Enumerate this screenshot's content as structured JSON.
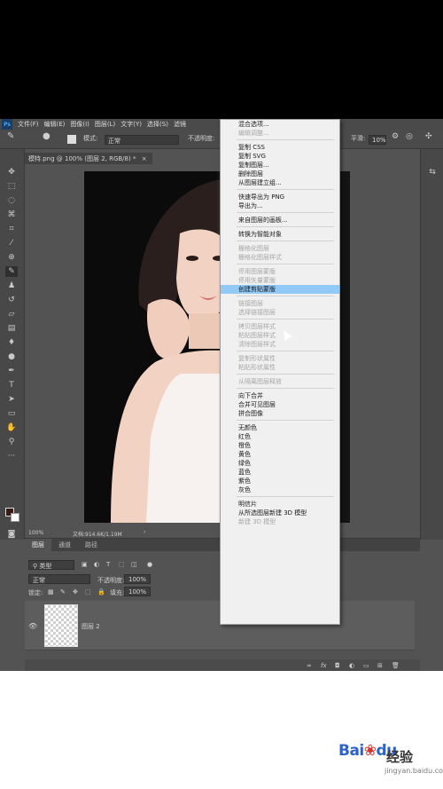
{
  "menubar": {
    "app_icon": "Ps",
    "items": [
      "文件(F)",
      "编辑(E)",
      "图像(I)",
      "图层(L)",
      "文字(Y)",
      "选择(S)",
      "滤镜"
    ]
  },
  "options": {
    "mode_label": "模式:",
    "mode_value": "正常",
    "opacity_label": "不透明度:",
    "smooth_label": "平滑:",
    "smooth_value": "10%"
  },
  "document": {
    "tab_title": "模特.png @ 100% (图层 2, RGB/8) *",
    "zoom": "100%",
    "doc_size": "文档:914.6K/1.19M"
  },
  "layers_panel": {
    "tabs": [
      "图层",
      "通道",
      "路径"
    ],
    "filter_kind": "类型",
    "blend_mode": "正常",
    "opacity_label": "不透明度:",
    "opacity_value": "100%",
    "lock_label": "锁定:",
    "fill_label": "填充:",
    "fill_value": "100%",
    "layer_name": "图层 2"
  },
  "context_menu": {
    "items": [
      {
        "label": "混合选项...",
        "disabled": false
      },
      {
        "label": "编辑调整...",
        "disabled": true
      },
      {
        "sep": true
      },
      {
        "label": "复制 CSS",
        "disabled": false
      },
      {
        "label": "复制 SVG",
        "disabled": false
      },
      {
        "label": "复制图层...",
        "disabled": false
      },
      {
        "label": "删除图层",
        "disabled": false
      },
      {
        "label": "从图层建立组...",
        "disabled": false
      },
      {
        "sep": true
      },
      {
        "label": "快速导出为 PNG",
        "disabled": false
      },
      {
        "label": "导出为...",
        "disabled": false
      },
      {
        "sep": true
      },
      {
        "label": "来自图层的画板...",
        "disabled": false
      },
      {
        "sep": true
      },
      {
        "label": "转换为智能对象",
        "disabled": false
      },
      {
        "sep": true
      },
      {
        "label": "栅格化图层",
        "disabled": true
      },
      {
        "label": "栅格化图层样式",
        "disabled": true
      },
      {
        "sep": true
      },
      {
        "label": "停用图层蒙版",
        "disabled": true
      },
      {
        "label": "停用矢量蒙版",
        "disabled": true
      },
      {
        "label": "创建剪贴蒙版",
        "disabled": false,
        "highlight": true
      },
      {
        "sep": true
      },
      {
        "label": "链接图层",
        "disabled": true
      },
      {
        "label": "选择链接图层",
        "disabled": true
      },
      {
        "sep": true
      },
      {
        "label": "拷贝图层样式",
        "disabled": true
      },
      {
        "label": "粘贴图层样式",
        "disabled": true
      },
      {
        "label": "清除图层样式",
        "disabled": true
      },
      {
        "sep": true
      },
      {
        "label": "复制形状属性",
        "disabled": true
      },
      {
        "label": "粘贴形状属性",
        "disabled": true
      },
      {
        "sep": true
      },
      {
        "label": "从隔离图层释放",
        "disabled": true
      },
      {
        "sep": true
      },
      {
        "label": "向下合并",
        "disabled": false
      },
      {
        "label": "合并可见图层",
        "disabled": false
      },
      {
        "label": "拼合图像",
        "disabled": false
      },
      {
        "sep": true
      },
      {
        "label": "无颜色",
        "disabled": false
      },
      {
        "label": "红色",
        "disabled": false
      },
      {
        "label": "橙色",
        "disabled": false
      },
      {
        "label": "黄色",
        "disabled": false
      },
      {
        "label": "绿色",
        "disabled": false
      },
      {
        "label": "蓝色",
        "disabled": false
      },
      {
        "label": "紫色",
        "disabled": false
      },
      {
        "label": "灰色",
        "disabled": false
      },
      {
        "sep": true
      },
      {
        "label": "明信片",
        "disabled": false
      },
      {
        "label": "从所选图层新建 3D 模型",
        "disabled": false
      },
      {
        "label": "新建 3D 模型",
        "disabled": true
      }
    ]
  },
  "watermark": {
    "logo": "Bai",
    "logo_suffix": "du",
    "brand": "经验",
    "url": "jingyan.baidu.com"
  },
  "colors": {
    "ui_bg": "#535353",
    "menu_highlight": "#91c9f7",
    "baidu_blue": "#2d62c9"
  }
}
